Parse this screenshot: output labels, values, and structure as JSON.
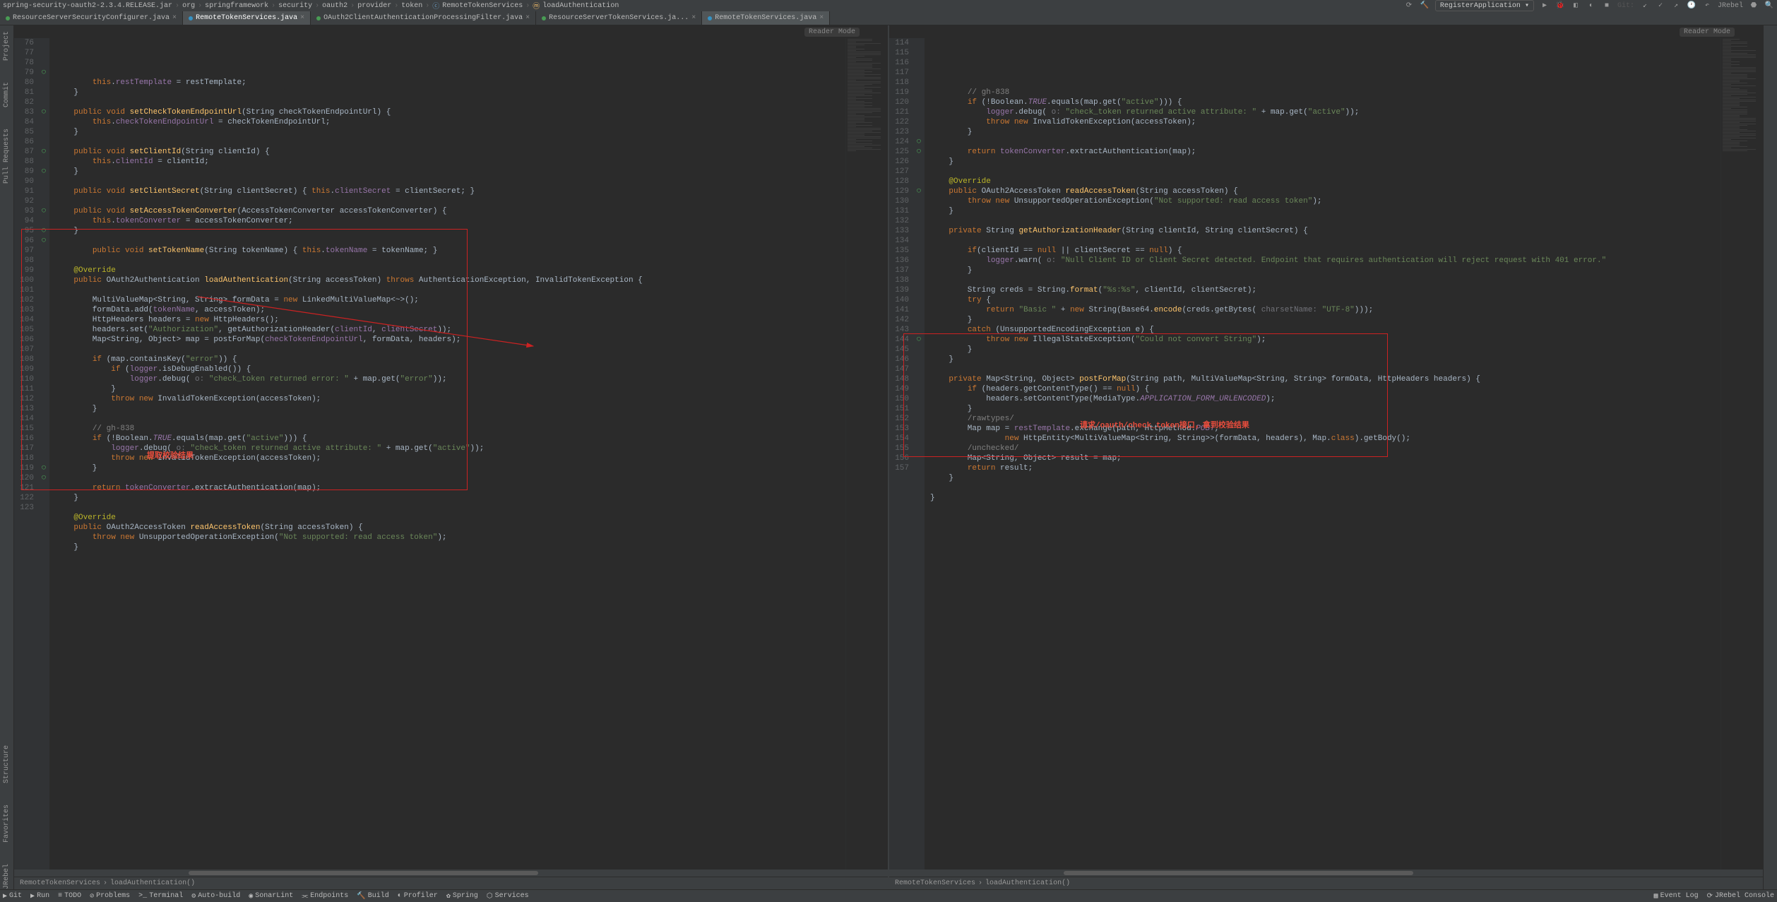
{
  "menubar": {
    "jar": "spring-security-oauth2-2.3.4.RELEASE.jar",
    "path": [
      "org",
      "springframework",
      "security",
      "oauth2",
      "provider",
      "token"
    ],
    "cls": "RemoteTokenServices",
    "method": "loadAuthentication"
  },
  "toolbar": {
    "runconfig": "RegisterApplication",
    "search": "🔍",
    "user": "JRebel"
  },
  "tabs": [
    {
      "label": "ResourceServerSecurityConfigurer.java",
      "active": false,
      "kind": "green"
    },
    {
      "label": "RemoteTokenServices.java",
      "active": true,
      "kind": "blue"
    },
    {
      "label": "OAuth2ClientAuthenticationProcessingFilter.java",
      "active": false,
      "kind": "green"
    },
    {
      "label": "ResourceServerTokenServices.ja...",
      "active": false,
      "kind": "green"
    },
    {
      "label": "RemoteTokenServices.java",
      "active": true,
      "kind": "blue"
    }
  ],
  "reader_mode": "Reader Mode",
  "left": {
    "start": 76,
    "lines": [
      "        <span class='kw'>this</span>.<span class='fld'>restTemplate</span> = restTemplate;",
      "    }",
      "",
      "    <span class='kw'>public void</span> <span class='mth'>setCheckTokenEndpointUrl</span>(String checkTokenEndpointUrl) {",
      "        <span class='kw'>this</span>.<span class='fld'>checkTokenEndpointUrl</span> = checkTokenEndpointUrl;",
      "    }",
      "",
      "    <span class='kw'>public void</span> <span class='mth'>setClientId</span>(String clientId) {",
      "        <span class='kw'>this</span>.<span class='fld'>clientId</span> = clientId;",
      "    }",
      "",
      "    <span class='kw'>public void</span> <span class='mth'>setClientSecret</span>(String clientSecret) { <span class='kw'>this</span>.<span class='fld'>clientSecret</span> = clientSecret; }",
      "",
      "    <span class='kw'>public void</span> <span class='mth'>setAccessTokenConverter</span>(AccessTokenConverter accessTokenConverter) {",
      "        <span class='kw'>this</span>.<span class='fld'>tokenConverter</span> = accessTokenConverter;",
      "    }",
      "",
      "        <span class='kw'>public void</span> <span class='mth'>setTokenName</span>(String tokenName) { <span class='kw'>this</span>.<span class='fld'>tokenName</span> = tokenName; }",
      "",
      "    <span class='ann'>@Override</span>",
      "    <span class='kw'>public</span> OAuth2Authentication <span class='mth'>loadAuthentication</span>(String accessToken) <span class='kw'>throws</span> AuthenticationException, InvalidTokenException {",
      "",
      "        MultiValueMap&lt;String, String&gt; formData = <span class='kw'>new</span> LinkedMultiValueMap&lt;~&gt;();",
      "        formData.add(<span class='fld'>tokenName</span>, accessToken);",
      "        HttpHeaders headers = <span class='kw'>new</span> HttpHeaders();",
      "        headers.set(<span class='str'>\"Authorization\"</span>, getAuthorizationHeader(<span class='fld'>clientId</span>, <span class='fld'>clientSecret</span>));",
      "        Map&lt;String, Object&gt; map = postForMap(<span class='fld'>checkTokenEndpointUrl</span>, formData, headers);",
      "",
      "        <span class='kw'>if</span> (map.containsKey(<span class='str'>\"error\"</span>)) {",
      "            <span class='kw'>if</span> (<span class='fld'>logger</span>.isDebugEnabled()) {",
      "                <span class='fld'>logger</span>.debug( <span class='prm'>o:</span> <span class='str'>\"check_token returned error: \"</span> + map.get(<span class='str'>\"error\"</span>));",
      "            }",
      "            <span class='kw'>throw new</span> InvalidTokenException(accessToken);",
      "        }",
      "",
      "        <span class='cmt'>// gh-838</span>",
      "        <span class='kw'>if</span> (!Boolean.<span class='cn'>TRUE</span>.equals(map.get(<span class='str'>\"active\"</span>))) {",
      "            <span class='fld'>logger</span>.debug( <span class='prm'>o:</span> <span class='str'>\"check_token returned active attribute: \"</span> + map.get(<span class='str'>\"active\"</span>));",
      "            <span class='kw'>throw new</span> InvalidTokenException(accessToken);",
      "        }",
      "",
      "        <span class='kw'>return</span> <span class='fld'>tokenConverter</span>.extractAuthentication(map);",
      "    }",
      "",
      "    <span class='ann'>@Override</span>",
      "    <span class='kw'>public</span> OAuth2AccessToken <span class='mth'>readAccessToken</span>(String accessToken) {",
      "        <span class='kw'>throw new</span> UnsupportedOperationException(<span class='str'>\"Not supported: read access token\"</span>);",
      "    }"
    ],
    "annotation": "提取校验结果"
  },
  "right": {
    "start": 114,
    "lines": [
      "",
      "        <span class='cmt'>// gh-838</span>",
      "        <span class='kw'>if</span> (!Boolean.<span class='cn'>TRUE</span>.equals(map.get(<span class='str'>\"active\"</span>))) {",
      "            <span class='fld'>logger</span>.debug( <span class='prm'>o:</span> <span class='str'>\"check_token returned active attribute: \"</span> + map.get(<span class='str'>\"active\"</span>));",
      "            <span class='kw'>throw new</span> InvalidTokenException(accessToken);",
      "        }",
      "",
      "        <span class='kw'>return</span> <span class='fld'>tokenConverter</span>.extractAuthentication(map);",
      "    }",
      "",
      "    <span class='ann'>@Override</span>",
      "    <span class='kw'>public</span> OAuth2AccessToken <span class='mth'>readAccessToken</span>(String accessToken) {",
      "        <span class='kw'>throw new</span> UnsupportedOperationException(<span class='str'>\"Not supported: read access token\"</span>);",
      "    }",
      "",
      "    <span class='kw'>private</span> String <span class='mth'>getAuthorizationHeader</span>(String clientId, String clientSecret) {",
      "",
      "        <span class='kw'>if</span>(clientId == <span class='kw'>null</span> || clientSecret == <span class='kw'>null</span>) {",
      "            <span class='fld'>logger</span>.warn( <span class='prm'>o:</span> <span class='str'>\"Null Client ID or Client Secret detected. Endpoint that requires authentication will reject request with 401 error.\"</span>",
      "        }",
      "",
      "        String creds = String.<span class='mth'>format</span>(<span class='str'>\"%s:%s\"</span>, clientId, clientSecret);",
      "        <span class='kw'>try</span> {",
      "            <span class='kw'>return</span> <span class='str'>\"Basic \"</span> + <span class='kw'>new</span> String(Base64.<span class='mth'>encode</span>(creds.getBytes( <span class='prm'>charsetName:</span> <span class='str'>\"UTF-8\"</span>)));",
      "        }",
      "        <span class='kw'>catch</span> (UnsupportedEncodingException e) {",
      "            <span class='kw'>throw new</span> IllegalStateException(<span class='str'>\"Could not convert String\"</span>);",
      "        }",
      "    }",
      "",
      "    <span class='kw'>private</span> Map&lt;String, Object&gt; <span class='mth'>postForMap</span>(String path, MultiValueMap&lt;String, String&gt; formData, HttpHeaders headers) {",
      "        <span class='kw'>if</span> (headers.getContentType() == <span class='kw'>null</span>) {",
      "            headers.setContentType(MediaType.<span class='cn'>APPLICATION_FORM_URLENCODED</span>);",
      "        }",
      "        <span class='cmt'>/rawtypes/</span>",
      "        Map map = <span class='fld'>restTemplate</span>.exchange(path, HttpMethod.<span class='cn'>POST</span>,",
      "                <span class='kw'>new</span> HttpEntity&lt;MultiValueMap&lt;String, String&gt;&gt;(formData, headers), Map.<span class='kw'>class</span>).getBody();",
      "        <span class='cmt'>/unchecked/</span>",
      "        Map&lt;String, Object&gt; result = map;",
      "        <span class='kw'>return</span> result;",
      "    }",
      "",
      "}",
      ""
    ],
    "annotation": "请求/oauth/check_token接口，拿到校验结果"
  },
  "breadcrumb": [
    "RemoteTokenServices",
    "loadAuthentication()"
  ],
  "status": {
    "left": [
      {
        "icon": "▶",
        "label": "Git"
      },
      {
        "icon": "▶",
        "label": "Run"
      },
      {
        "icon": "≡",
        "label": "TODO"
      },
      {
        "icon": "⊘",
        "label": "Problems"
      },
      {
        "icon": ">_",
        "label": "Terminal"
      },
      {
        "icon": "⚙",
        "label": "Auto-build"
      },
      {
        "icon": "◉",
        "label": "SonarLint"
      },
      {
        "icon": "⫘",
        "label": "Endpoints"
      },
      {
        "icon": "🔨",
        "label": "Build"
      },
      {
        "icon": "◐",
        "label": "Profiler"
      },
      {
        "icon": "✿",
        "label": "Spring"
      },
      {
        "icon": "⬡",
        "label": "Services"
      }
    ],
    "right": [
      {
        "icon": "▦",
        "label": "Event Log"
      },
      {
        "icon": "⟳",
        "label": "JRebel Console"
      }
    ]
  },
  "leftbar": [
    "Project",
    "Commit",
    "Pull Requests",
    "Structure",
    "Favorites",
    "JRebel"
  ]
}
